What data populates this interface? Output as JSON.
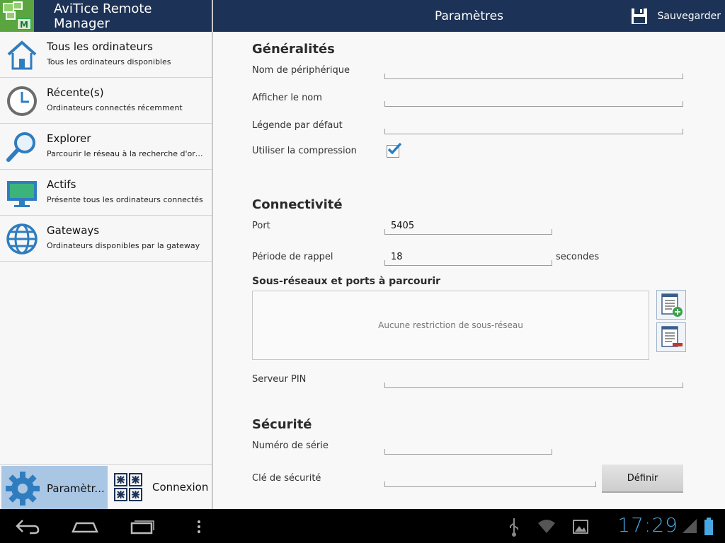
{
  "app": {
    "title": "AviTice Remote Manager",
    "logo_letter": "M"
  },
  "header": {
    "title": "Paramètres",
    "save_label": "Sauvegarder"
  },
  "sidebar": {
    "items": [
      {
        "title": "Tous les ordinateurs",
        "subtitle": "Tous les ordinateurs disponibles",
        "icon": "home-icon"
      },
      {
        "title": "Récente(s)",
        "subtitle": "Ordinateurs connectés récemment",
        "icon": "clock-icon"
      },
      {
        "title": "Explorer",
        "subtitle": "Parcourir le réseau à la recherche d'ordinateurs",
        "icon": "magnifier-icon"
      },
      {
        "title": "Actifs",
        "subtitle": "Présente tous les ordinateurs connectés",
        "icon": "monitor-icon"
      },
      {
        "title": "Gateways",
        "subtitle": "Ordinateurs disponibles par la gateway",
        "icon": "globe-icon"
      }
    ],
    "bottom_tabs": {
      "settings_label": "Paramètr...",
      "connect_label": "Connexion"
    }
  },
  "settings": {
    "general": {
      "heading": "Généralités",
      "device_name_label": "Nom de périphérique",
      "device_name_value": "",
      "display_name_label": "Afficher le nom",
      "display_name_value": "",
      "default_caption_label": "Légende par défaut",
      "default_caption_value": "",
      "compression_label": "Utiliser la compression",
      "compression_checked": true
    },
    "connectivity": {
      "heading": "Connectivité",
      "port_label": "Port",
      "port_value": "5405",
      "callback_label": "Période de rappel",
      "callback_value": "18",
      "callback_unit": "secondes",
      "subnets_heading": "Sous-réseaux et ports à parcourir",
      "subnets_empty": "Aucune restriction de sous-réseau",
      "pin_label": "Serveur PIN",
      "pin_value": ""
    },
    "security": {
      "heading": "Sécurité",
      "serial_label": "Numéro de série",
      "serial_value": "",
      "key_label": "Clé de sécurité",
      "key_value": "",
      "define_label": "Définir"
    }
  },
  "status_bar": {
    "time": "17:29"
  },
  "colors": {
    "header_bg": "#1c3256",
    "selected_tab": "#a9c7e4",
    "accent": "#2a7fc3",
    "clock": "#48a6e0"
  }
}
